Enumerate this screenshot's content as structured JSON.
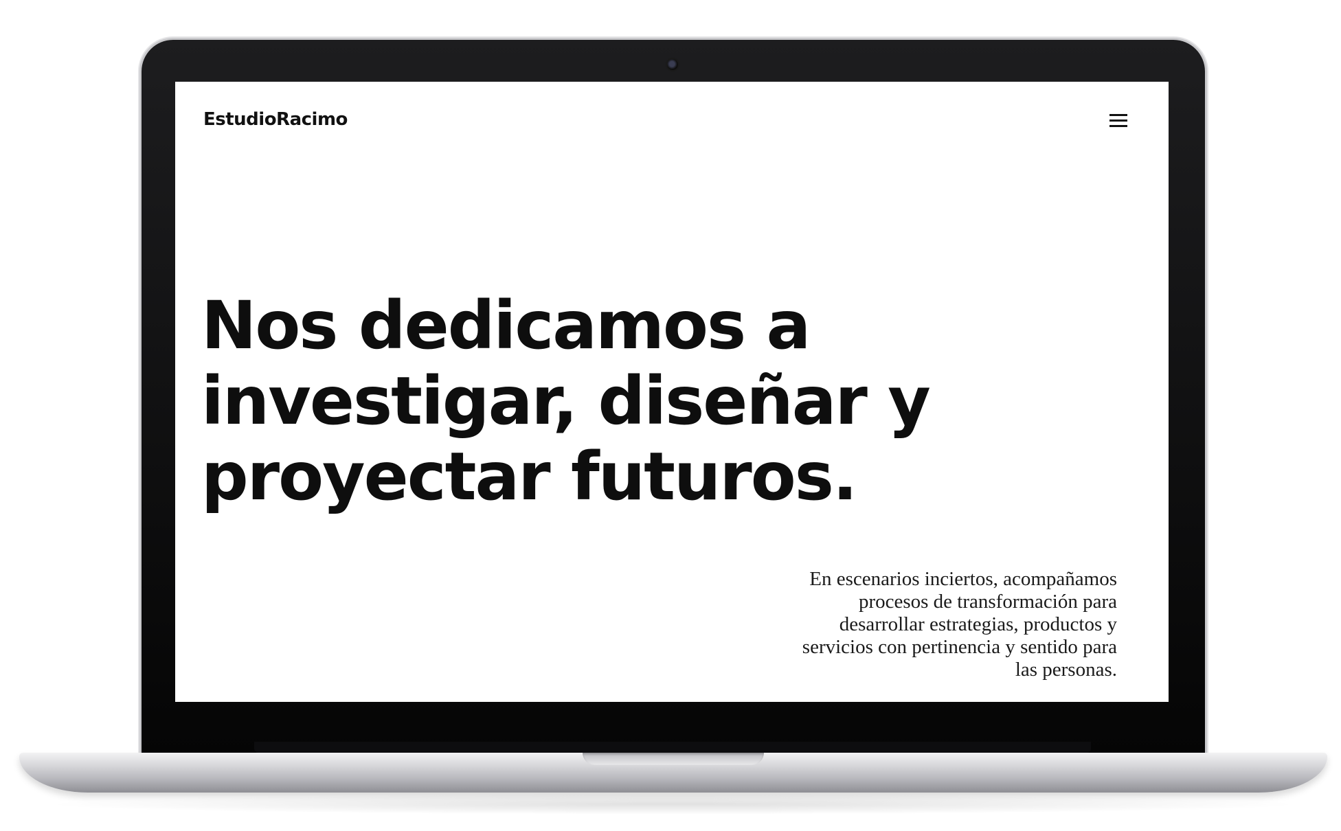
{
  "site": {
    "logo_text": "EstudioRacimo",
    "menu_icon": "hamburger-menu-icon"
  },
  "hero": {
    "headline_lines": [
      "Nos dedicamos a",
      "investigar, diseñar y",
      "proyectar futuros."
    ]
  },
  "intro": {
    "lines": [
      "En escenarios inciertos, acompañamos",
      "procesos de transformación para",
      "desarrollar estrategias, productos y",
      "servicios con pertinencia y sentido para",
      "las personas."
    ]
  },
  "colors": {
    "text": "#0e0e0e",
    "background": "#ffffff",
    "bezel": "#000000",
    "chassis": "#c8c8cc"
  }
}
